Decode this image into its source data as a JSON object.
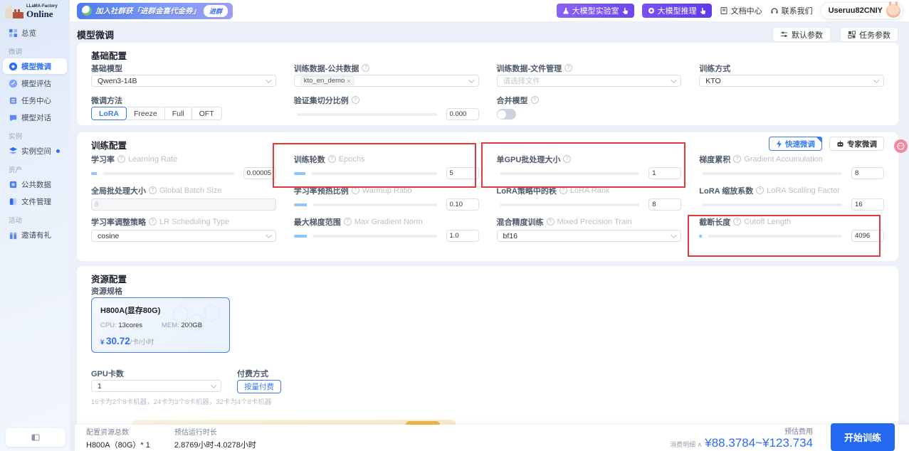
{
  "brand": {
    "small": "LLaMA-Factory",
    "big": "Online"
  },
  "banner": {
    "text": "加入社群获「进群金喜代金券」",
    "button": "进群"
  },
  "topnav": {
    "lab": "大模型实验室",
    "infer": "大模型推理",
    "docs": "文档中心",
    "contact": "联系我们",
    "user": "Useruu82CNIY"
  },
  "sidebar": {
    "overview": "总览",
    "sec_finetune": "微调",
    "item_finetune": "模型微调",
    "item_eval": "模型评估",
    "item_tasks": "任务中心",
    "item_chat": "模型对话",
    "sec_instance": "实例",
    "item_instance": "实例空间",
    "sec_assets": "资产",
    "item_public": "公共数据",
    "item_files": "文件管理",
    "sec_activity": "活动",
    "item_invite": "邀请有礼"
  },
  "page": {
    "title": "模型微调",
    "default_params": "默认参数",
    "task_params": "任务参数"
  },
  "basic": {
    "title": "基础配置",
    "base_model": {
      "label": "基础模型",
      "value": "Qwen3-14B"
    },
    "public_data": {
      "label": "训练数据-公共数据",
      "tag": "kto_en_demo"
    },
    "file_data": {
      "label": "训练数据-文件管理",
      "placeholder": "请选择文件"
    },
    "train_method": {
      "label": "训练方式",
      "value": "KTO"
    },
    "ft_method": {
      "label": "微调方法",
      "opt1": "LoRA",
      "opt2": "Freeze",
      "opt3": "Full",
      "opt4": "OFT",
      "selected": "LoRA"
    },
    "val_split": {
      "label": "验证集切分比例",
      "value": "0.000"
    },
    "merge": {
      "label": "合并模型"
    }
  },
  "training": {
    "title": "训练配置",
    "quick_btn": "快速微调",
    "expert_btn": "专家微调",
    "fields": [
      {
        "label": "学习率",
        "en": "Learning Rate",
        "value": "0.00005",
        "pct": 6
      },
      {
        "label": "训练轮数",
        "en": "Epochs",
        "value": "5",
        "pct": 10
      },
      {
        "label": "单GPU批处理大小",
        "en": "",
        "value": "1",
        "pct": 0
      },
      {
        "label": "梯度累积",
        "en": "Gradient Accumulation",
        "value": "8",
        "pct": 0
      },
      {
        "label": "全局批处理大小",
        "en": "Global Batch Size",
        "value": "8"
      },
      {
        "label": "学习率预热比例",
        "en": "Warmup Ratio",
        "value": "0.10",
        "pct": 11
      },
      {
        "label": "LoRA策略中的秩",
        "en": "LoRA Rank",
        "value": "8",
        "pct": 0
      },
      {
        "label": "LoRA 缩放系数",
        "en": "LoRA Scalling Factor",
        "value": "16",
        "pct": 0
      },
      {
        "label": "学习率调整策略",
        "en": "LR Scheduling Type",
        "value": "cosine"
      },
      {
        "label": "最大梯度范围",
        "en": "Max Gradient Norm",
        "value": "1.0",
        "pct": 11
      },
      {
        "label": "混合精度训练",
        "en": "Mixed Precision Train",
        "value": "bf16"
      },
      {
        "label": "截断长度",
        "en": "Cutoff Length",
        "value": "4096",
        "pct": 4
      }
    ]
  },
  "resources": {
    "title": "资源配置",
    "spec_label": "资源规格",
    "card": {
      "name": "H800A(显存80G)",
      "cpu_k": "CPU:",
      "cpu_v": "13cores",
      "mem_k": "MEM:",
      "mem_v": "200GB",
      "cur": "¥",
      "price": "30.72",
      "unit": "/卡/小时"
    },
    "gpu": {
      "label": "GPU卡数",
      "value": "1",
      "hint": "16卡为2个8卡机器，24卡为3个8卡机器，32卡为4个8卡机器"
    },
    "pay": {
      "label": "付费方式",
      "button": "按量付费"
    }
  },
  "footer": {
    "total_label": "配置资源总数",
    "total_value": "H800A（80G）* 1",
    "dur_label": "预估运行时长",
    "dur_value": "2.8769小时-4.0278小时",
    "cost_label": "预估费用",
    "detail": "消费明细 ∧",
    "price": "¥88.3784~¥123.734",
    "start": "开始训练"
  }
}
